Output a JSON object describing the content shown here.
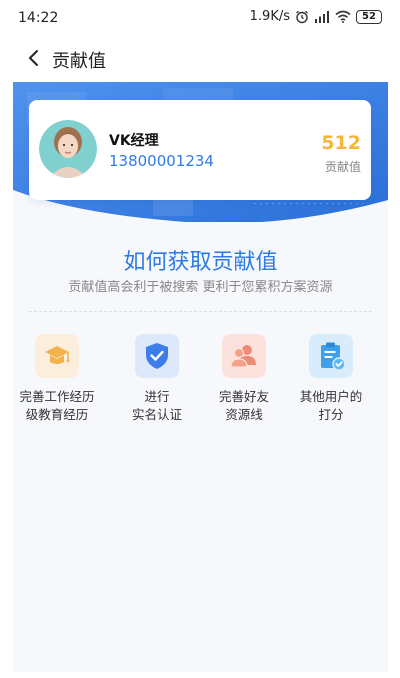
{
  "status_bar": {
    "time": "14:22",
    "network_speed": "1.9K/s",
    "battery": "52",
    "icons": [
      "alarm-icon",
      "signal-icon",
      "wifi-icon",
      "battery-icon"
    ]
  },
  "nav": {
    "title": "贡献值",
    "back_icon": "chevron-left-icon"
  },
  "profile": {
    "name": "VK经理",
    "phone": "13800001234",
    "score": "512",
    "score_label": "贡献值"
  },
  "how": {
    "title": "如何获取贡献值",
    "subtitle": "贡献值高会利于被搜索 更利于您累积方案资源"
  },
  "ways": [
    {
      "icon": "graduation-cap-icon",
      "line1": "完善工作经历",
      "line2": "级教育经历",
      "bg": "#fbeedd",
      "color": "#f2b24e"
    },
    {
      "icon": "shield-check-icon",
      "line1": "进行",
      "line2": "实名认证",
      "bg": "#dde8fb",
      "color": "#3d7de8"
    },
    {
      "icon": "users-icon",
      "line1": "完善好友",
      "line2": "资源线",
      "bg": "#fbe2dc",
      "color": "#ee8b74"
    },
    {
      "icon": "clipboard-check-icon",
      "line1": "其他用户的",
      "line2": "打分",
      "bg": "#d9ecfb",
      "color": "#3fa0ea"
    }
  ],
  "colors": {
    "accent": "#2f7be6",
    "score": "#f5b63a",
    "hero": "#2f7be6"
  }
}
